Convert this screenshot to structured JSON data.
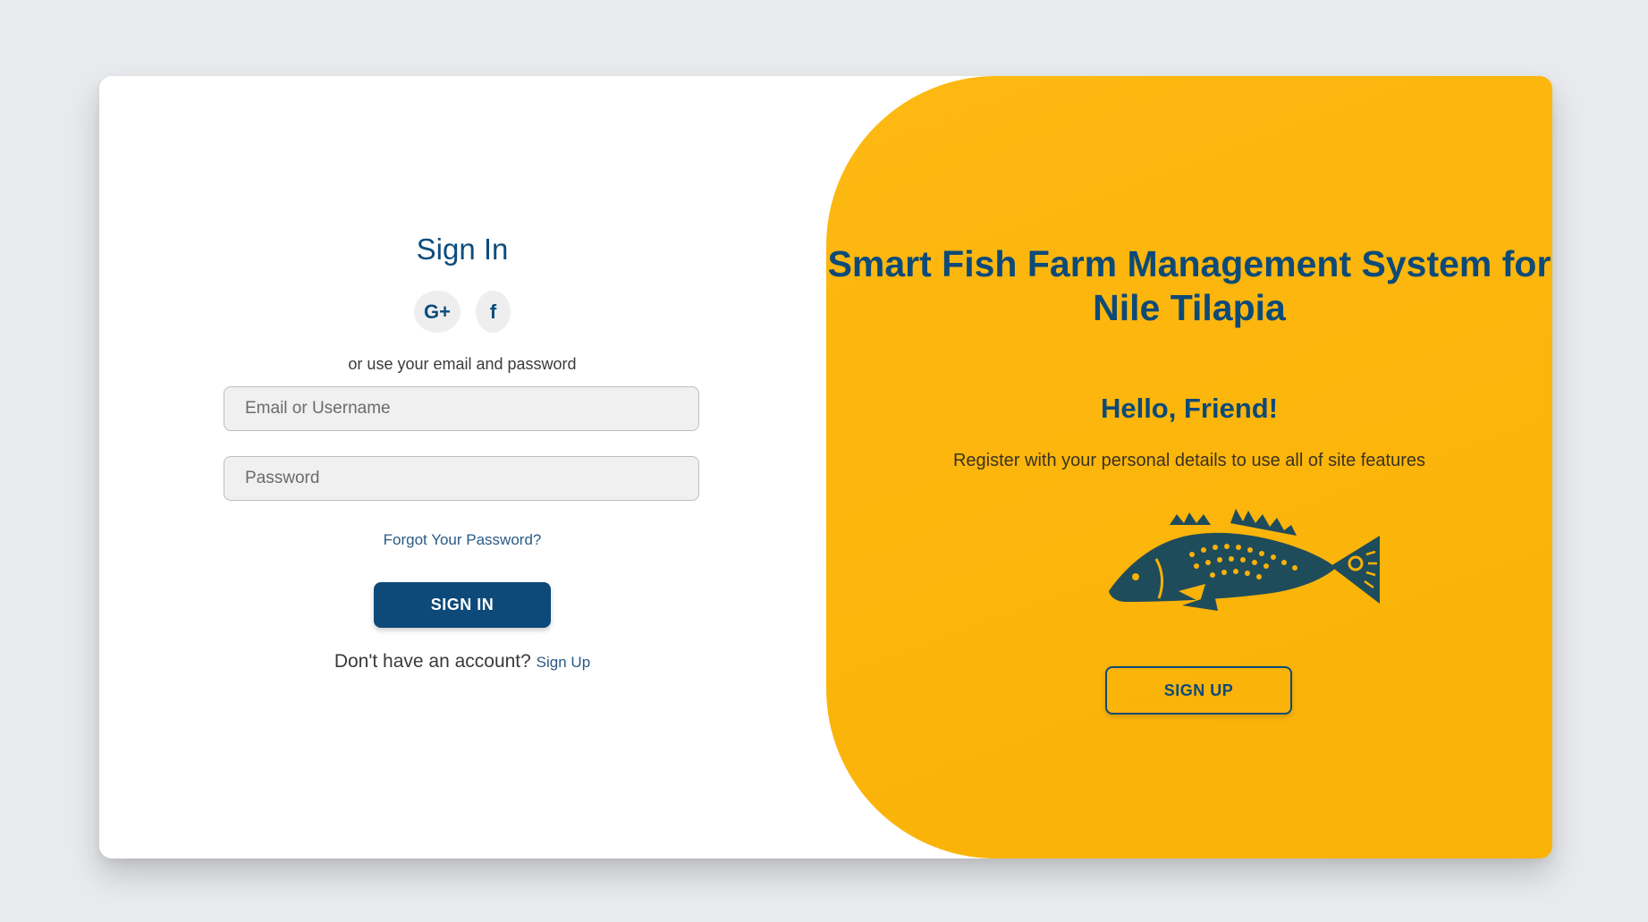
{
  "signin": {
    "title": "Sign In",
    "social": {
      "google_label": "G+",
      "facebook_label": "f"
    },
    "alt_text": "or use your email and password",
    "email_placeholder": "Email or Username",
    "password_placeholder": "Password",
    "forgot_label": "Forgot Your Password?",
    "button_label": "SIGN IN",
    "no_account_text": "Don't have an account?",
    "signup_link_label": "Sign Up"
  },
  "panel": {
    "title": "Smart Fish Farm Management System for Nile Tilapia",
    "greeting": "Hello, Friend!",
    "description": "Register with your personal details to use all of site features",
    "signup_button_label": "SIGN UP",
    "illustration": "fish-illustration"
  },
  "colors": {
    "background": "#e8eaed",
    "primary_blue": "#0d4a7a",
    "panel_yellow": "#fbb50b",
    "input_bg": "#f0f0f0"
  }
}
